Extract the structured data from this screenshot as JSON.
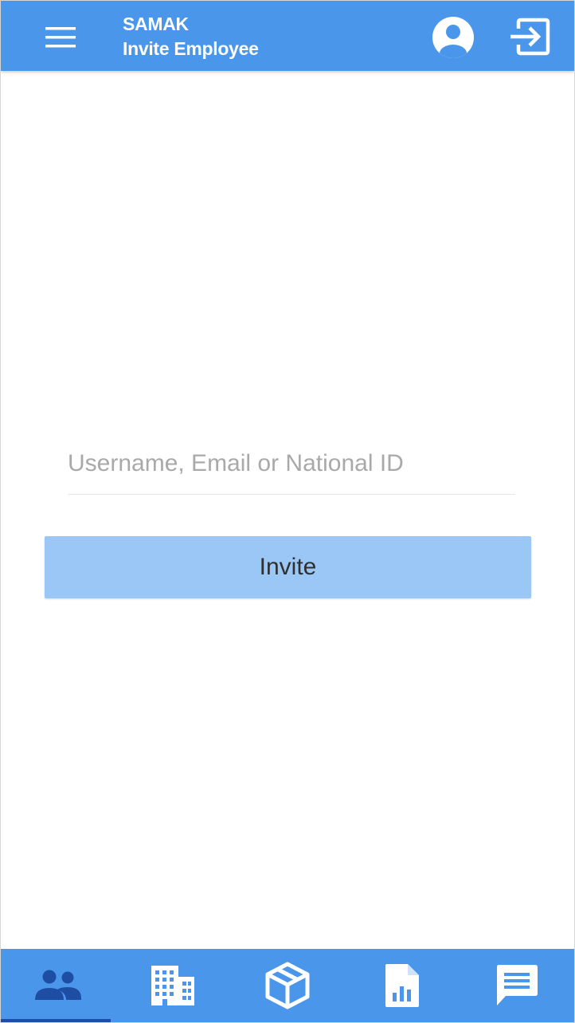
{
  "header": {
    "app_name": "SAMAK",
    "page_title": "Invite Employee"
  },
  "icons": {
    "menu": "menu-icon",
    "account": "account-circle-icon",
    "logout": "logout-icon",
    "employees": "people-icon",
    "buildings": "building-icon",
    "packages": "box-icon",
    "reports": "report-document-icon",
    "messages": "chat-icon"
  },
  "form": {
    "identifier_placeholder": "Username, Email or National ID",
    "identifier_value": "",
    "invite_label": "Invite"
  },
  "bottom_nav": {
    "active_tab": "employees"
  },
  "colors": {
    "app_bar": "#4a96ea",
    "active_icon": "#1d4ea3",
    "invite_button": "#9ac7f5"
  }
}
